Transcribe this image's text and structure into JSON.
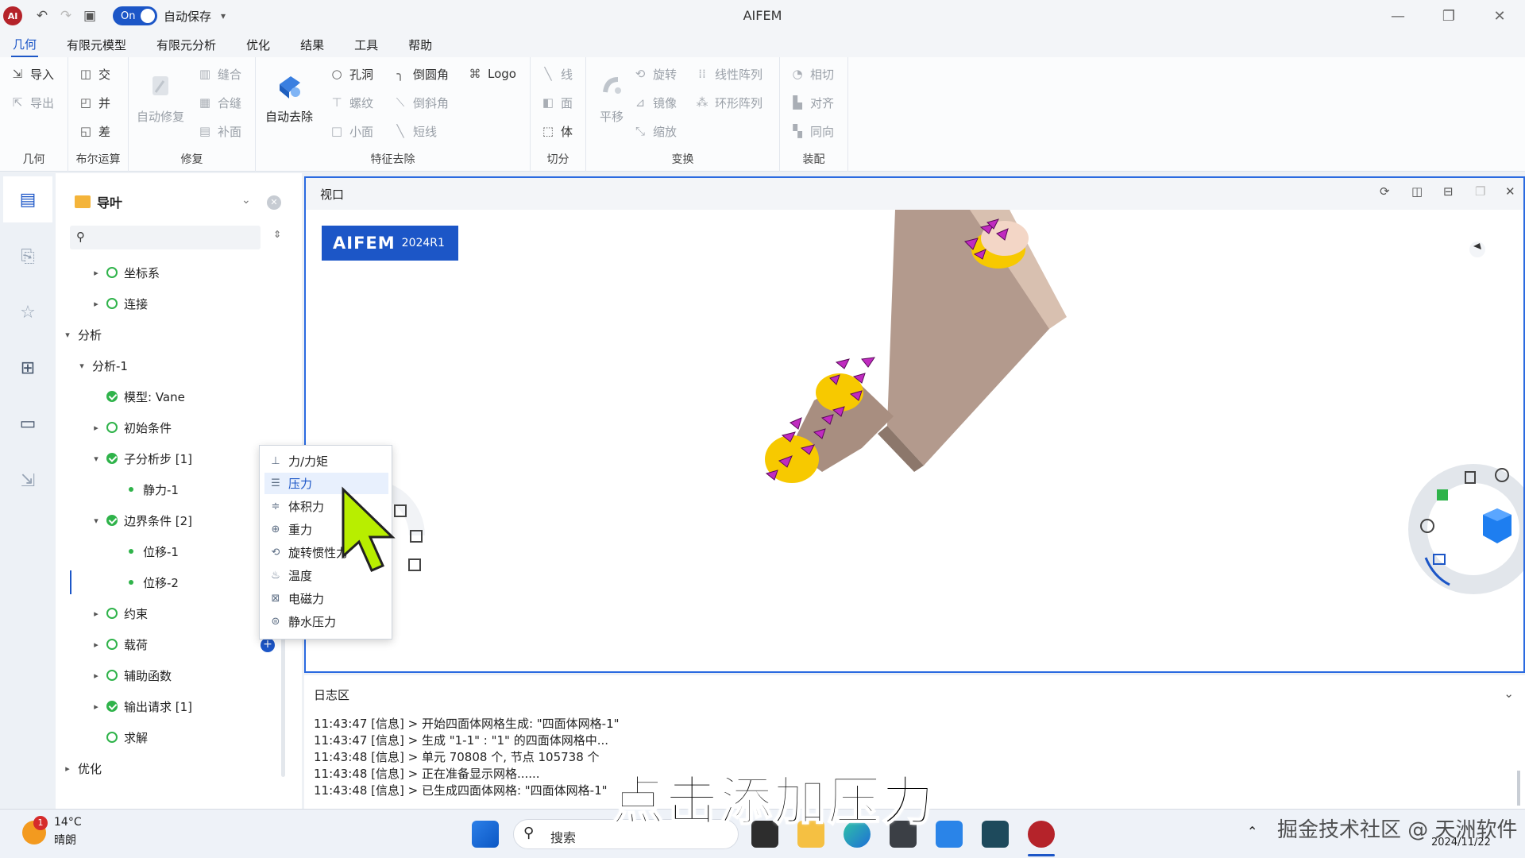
{
  "titlebar": {
    "title": "AIFEM",
    "toggle_label": "On",
    "autosave_label": "自动保存"
  },
  "menu": [
    "几何",
    "有限元模型",
    "有限元分析",
    "优化",
    "结果",
    "工具",
    "帮助"
  ],
  "ribbon": {
    "geom": {
      "import": "导入",
      "export": "导出",
      "label": "几何"
    },
    "boolean": {
      "intersect": "交",
      "union": "并",
      "diff": "差",
      "label": "布尔运算"
    },
    "repair": {
      "auto_repair": "自动修复",
      "sew": "缝合",
      "merge": "合缝",
      "patch": "补面",
      "label": "修复"
    },
    "feature": {
      "auto_remove": "自动去除",
      "hole": "孔洞",
      "thread": "螺纹",
      "small_face": "小面",
      "fillet": "倒圆角",
      "chamfer": "倒斜角",
      "short_edge": "短线",
      "logo": "Logo",
      "label": "特征去除"
    },
    "cut": {
      "line": "线",
      "face": "面",
      "body": "体",
      "label": "切分"
    },
    "transform": {
      "translate": "平移",
      "rotate": "旋转",
      "mirror": "镜像",
      "scale": "缩放",
      "linear_array": "线性阵列",
      "ring_array": "环形阵列",
      "label": "变换"
    },
    "assembly": {
      "tangent": "相切",
      "align": "对齐",
      "same_dir": "同向",
      "label": "装配"
    }
  },
  "navigator": {
    "title": "导叶",
    "tree": {
      "coord": "坐标系",
      "connect": "连接",
      "analysis": "分析",
      "analysis1": "分析-1",
      "model": "模型:   Vane",
      "init": "初始条件",
      "substep": "子分析步  [1]",
      "static": "静力-1",
      "bc": "边界条件  [2]",
      "disp1": "位移-1",
      "disp2": "位移-2",
      "constraint": "约束",
      "load": "载荷",
      "aux": "辅助函数",
      "output": "输出请求  [1]",
      "solve": "求解",
      "optimize": "优化"
    }
  },
  "context_menu": [
    "力/力矩",
    "压力",
    "体积力",
    "重力",
    "旋转惯性力",
    "温度",
    "电磁力",
    "静水压力"
  ],
  "viewport": {
    "title": "视口",
    "badge_name": "AIFEM",
    "badge_version": "2024R1"
  },
  "log": {
    "title": "日志区",
    "lines": [
      "11:43:47 [信息] > 开始四面体网格生成: \"四面体网格-1\"",
      "11:43:47 [信息] > 生成 \"1-1\" : \"1\" 的四面体网格中...",
      "11:43:48 [信息] > 单元 70808 个, 节点 105738 个",
      "11:43:48 [信息] > 正在准备显示网格......",
      "11:43:48 [信息] > 已生成四面体网格: \"四面体网格-1\""
    ]
  },
  "taskbar": {
    "weather_temp": "14°C",
    "weather_desc": "晴朗",
    "weather_badge": "1",
    "search_placeholder": "搜索",
    "date": "2024/11/22"
  },
  "overlay": {
    "subtitle": "点击添加压力",
    "watermark": "掘金技术社区 @ 天洲软件"
  },
  "colors": {
    "accent": "#1c56c7",
    "viewport_border": "#2a6ae0",
    "status_green": "#2fb34a",
    "part_body": "#a88e80",
    "part_face": "#f7c900",
    "marker": "#c02ac0"
  }
}
